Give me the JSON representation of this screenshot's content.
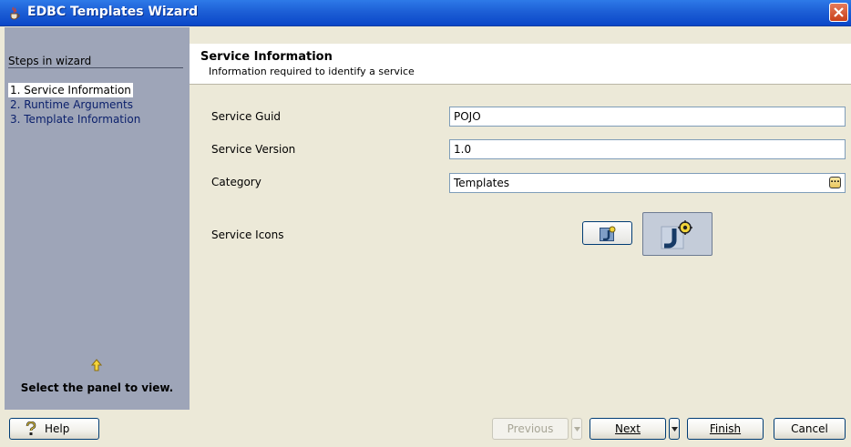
{
  "window": {
    "title": "EDBC Templates Wizard"
  },
  "steps": {
    "heading": "Steps in wizard",
    "items": [
      {
        "label": "1. Service Information",
        "active": true
      },
      {
        "label": "2. Runtime Arguments",
        "active": false
      },
      {
        "label": "3. Template Information",
        "active": false
      }
    ],
    "hint": "Select the panel to view."
  },
  "panel": {
    "title": "Service Information",
    "subtitle": "Information required to identify a service"
  },
  "form": {
    "guid_label": "Service Guid",
    "guid_value": "POJO",
    "version_label": "Service Version",
    "version_value": "1.0",
    "category_label": "Category",
    "category_value": "Templates",
    "icons_label": "Service Icons"
  },
  "buttons": {
    "help": "Help",
    "previous": "Previous",
    "next": "Next",
    "finish": "Finish",
    "cancel": "Cancel"
  },
  "colors": {
    "titlebar": "#1d5fd6",
    "steps_panel": "#9ea5b8",
    "dialog_bg": "#ece9d8"
  }
}
